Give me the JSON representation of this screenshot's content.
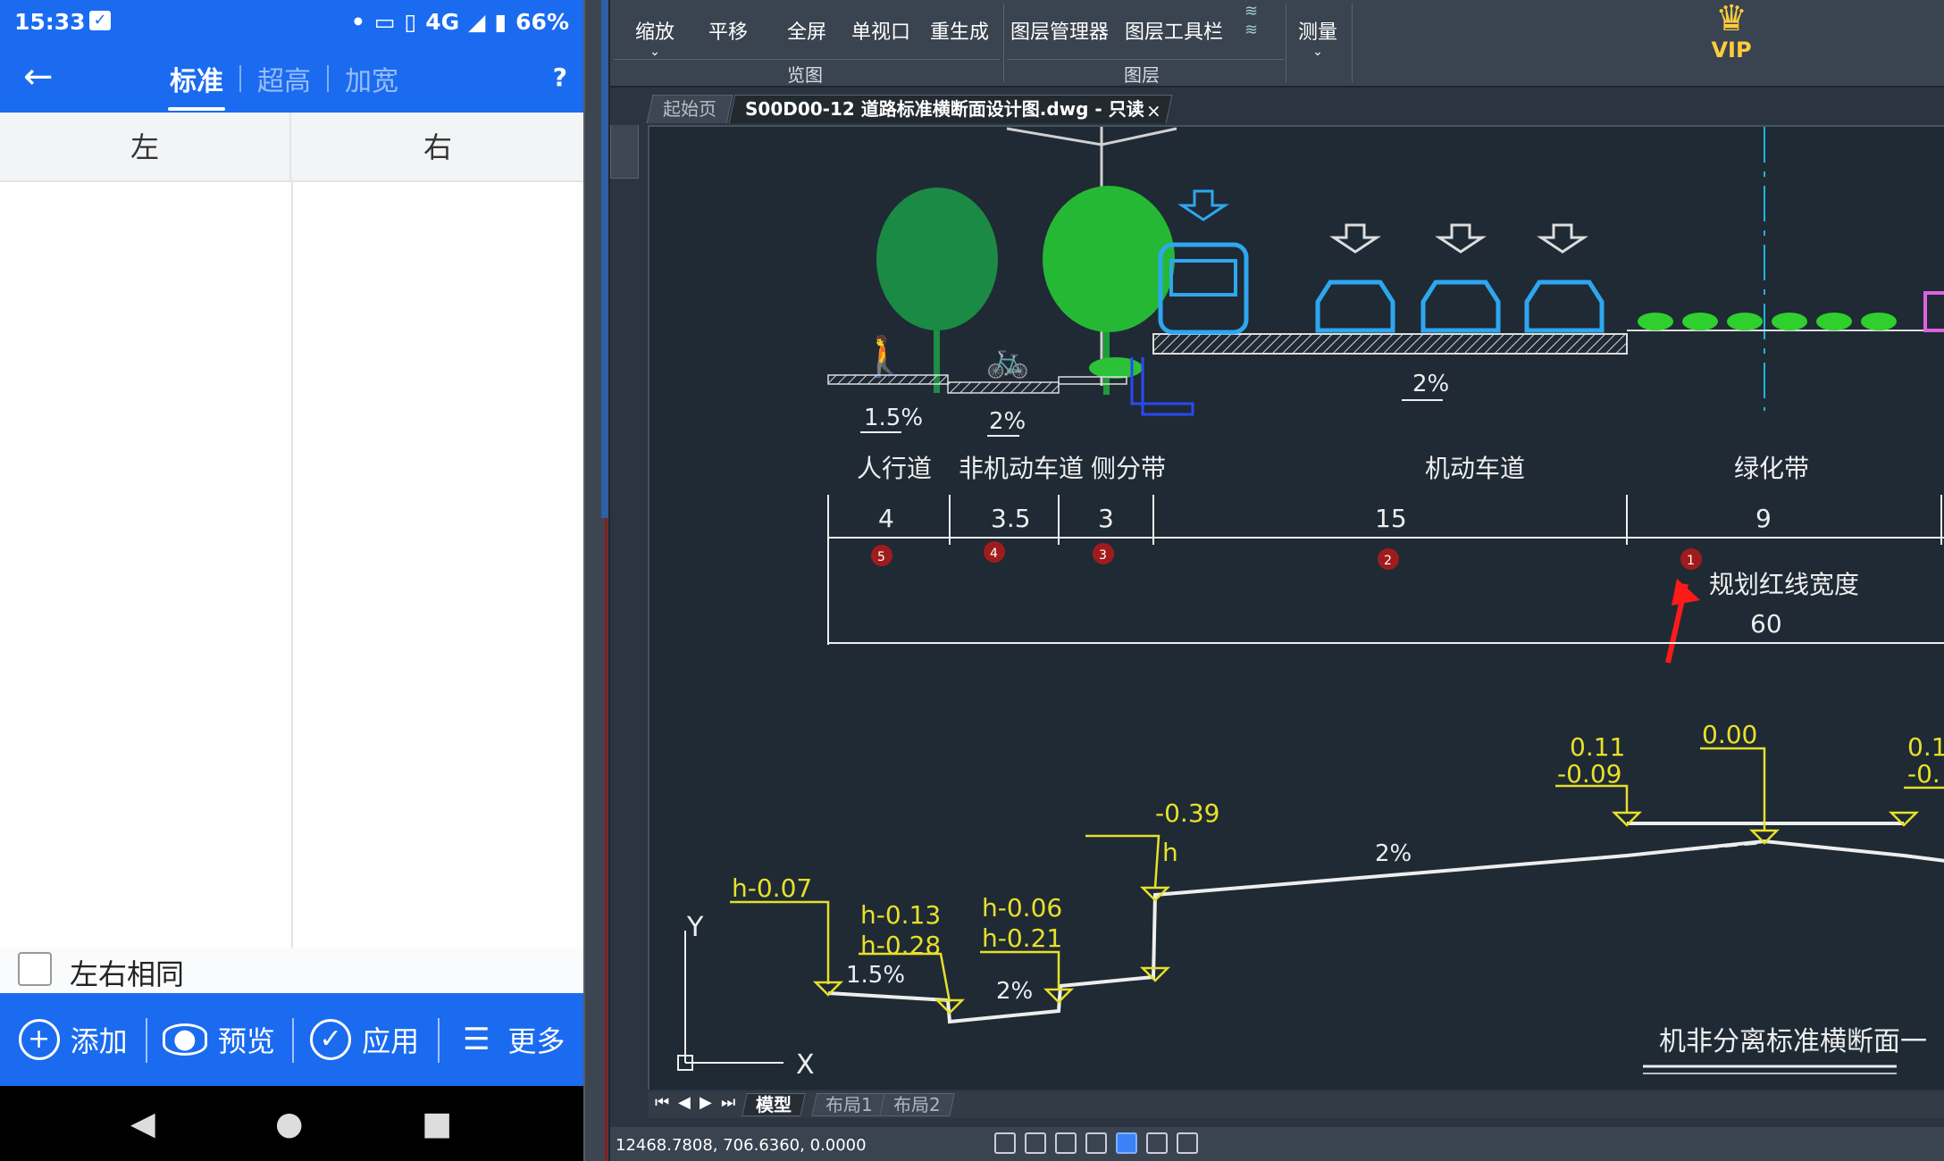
{
  "status_bar": {
    "time": "15:33",
    "dot": "•",
    "network": "4G",
    "battery": "66%"
  },
  "app_bar": {
    "back_icon": "arrow-left-icon",
    "tabs": [
      {
        "label": "标准",
        "active": true
      },
      {
        "label": "超高",
        "active": false
      },
      {
        "label": "加宽",
        "active": false
      }
    ],
    "help": "?"
  },
  "table": {
    "left_header": "左",
    "right_header": "右"
  },
  "same_lr": {
    "label": "左右相同",
    "checked": false
  },
  "bottom_bar": {
    "add": "添加",
    "preview": "预览",
    "apply": "应用",
    "more": "更多"
  },
  "cad": {
    "ribbon": {
      "buttons": [
        "缩放",
        "平移",
        "全屏",
        "单视口",
        "重生成",
        "图层管理器",
        "图层工具栏",
        "测量"
      ],
      "groups": [
        "览图",
        "图层"
      ],
      "vip": "VIP"
    },
    "tabs": {
      "home": "起始页",
      "doc": "S00D00-12 道路标准横断面设计图.dwg - 只读",
      "close": "×"
    },
    "layout_tabs": [
      "模型",
      "布局1",
      "布局2"
    ],
    "coords": "12468.7808, 706.6360, 0.0000",
    "drawing": {
      "labels": [
        "人行道",
        "非机动车道",
        "侧分带",
        "机动车道",
        "绿化带"
      ],
      "widths": [
        "4",
        "3.5",
        "3",
        "15",
        "9"
      ],
      "markers": [
        "5",
        "4",
        "3",
        "2",
        "1"
      ],
      "red_line_label": "规划红线宽度",
      "red_line_value": "60",
      "slopes_top": [
        "1.5%",
        "2%",
        "2%"
      ],
      "slope_bottom_1": "1.5%",
      "slope_bottom_2": "2%",
      "slope_bottom_3": "2%",
      "elev_h007": "h-0.07",
      "elev_h013": "h-0.13",
      "elev_h028": "h-0.28",
      "elev_h006": "h-0.06",
      "elev_h021": "h-0.21",
      "elev_n039": "-0.39",
      "elev_h": "h",
      "elev_011": "0.11",
      "elev_n009": "-0.09",
      "elev_000": "0.00",
      "elev_01_partial": "0.1",
      "elev_n0_partial": "-0.",
      "title": "机非分离标准横断面一",
      "axis_y": "Y",
      "axis_x": "X"
    }
  }
}
